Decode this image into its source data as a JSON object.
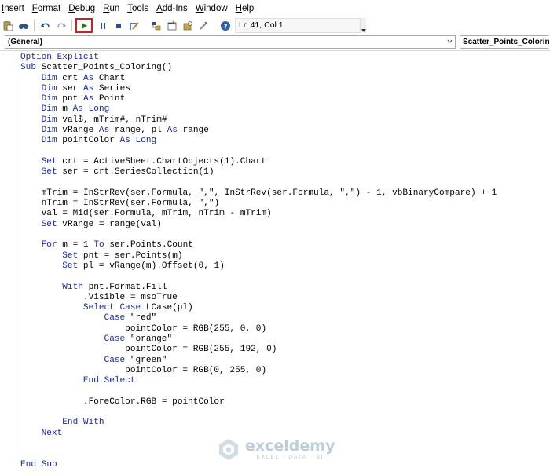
{
  "menubar": {
    "items": [
      {
        "label": "Insert",
        "underline": "I",
        "rest": "nsert"
      },
      {
        "label": "Format",
        "underline": "F",
        "rest": "ormat",
        "pre": "",
        "idx": 1
      },
      {
        "label": "Debug",
        "underline": "D",
        "rest": "ebug"
      },
      {
        "label": "Run",
        "underline": "R",
        "rest": "un"
      },
      {
        "label": "Tools",
        "underline": "T",
        "rest": "ools"
      },
      {
        "label": "Add-Ins",
        "underline": "A",
        "rest": "dd-Ins"
      },
      {
        "label": "Window",
        "underline": "W",
        "rest": "indow"
      },
      {
        "label": "Help",
        "underline": "H",
        "rest": "elp"
      }
    ]
  },
  "toolbar": {
    "icons": [
      "paste-icon",
      "find-icon",
      "undo-icon",
      "redo-icon",
      "run-icon",
      "break-icon",
      "reset-icon",
      "design-mode-icon",
      "project-explorer-icon",
      "properties-icon",
      "object-browser-icon",
      "toolbox-icon",
      "help-icon"
    ],
    "status": "Ln 41, Col 1"
  },
  "dropdowns": {
    "object": "(General)",
    "procedure": "Scatter_Points_Coloring"
  },
  "colors": {
    "keyword": "#1a2aa0",
    "highlight_box": "#d11f1f",
    "watermark": "#6a8fb5"
  },
  "code_lines": [
    "Option Explicit",
    "Sub Scatter_Points_Coloring()",
    "    Dim crt As Chart",
    "    Dim ser As Series",
    "    Dim pnt As Point",
    "    Dim m As Long",
    "    Dim val$, mTrim#, nTrim#",
    "    Dim vRange As range, pl As range",
    "    Dim pointColor As Long",
    "",
    "    Set crt = ActiveSheet.ChartObjects(1).Chart",
    "    Set ser = crt.SeriesCollection(1)",
    "",
    "    mTrim = InStrRev(ser.Formula, \",\", InStrRev(ser.Formula, \",\") - 1, vbBinaryCompare) + 1",
    "    nTrim = InStrRev(ser.Formula, \",\")",
    "    val = Mid(ser.Formula, mTrim, nTrim - mTrim)",
    "    Set vRange = range(val)",
    "",
    "    For m = 1 To ser.Points.Count",
    "        Set pnt = ser.Points(m)",
    "        Set pl = vRange(m).Offset(0, 1)",
    "",
    "        With pnt.Format.Fill",
    "            .Visible = msoTrue",
    "            Select Case LCase(pl)",
    "                Case \"red\"",
    "                    pointColor = RGB(255, 0, 0)",
    "                Case \"orange\"",
    "                    pointColor = RGB(255, 192, 0)",
    "                Case \"green\"",
    "                    pointColor = RGB(0, 255, 0)",
    "            End Select",
    "",
    "            .ForeColor.RGB = pointColor",
    "",
    "        End With",
    "    Next",
    "",
    "",
    "End Sub"
  ],
  "watermark": {
    "name": "exceldemy",
    "tagline": "EXCEL · DATA · BI"
  }
}
